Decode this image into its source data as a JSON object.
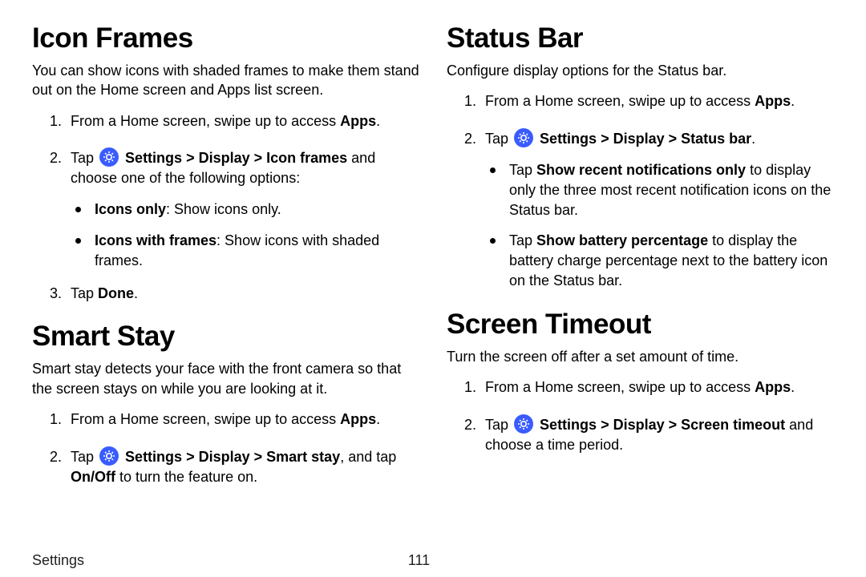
{
  "footer": {
    "section": "Settings",
    "page": "111"
  },
  "left": {
    "iconFrames": {
      "title": "Icon Frames",
      "intro": "You can show icons with shaded frames to make them stand out on the Home screen and Apps list screen.",
      "step1_pre": "From a Home screen, swipe up to access ",
      "step1_apps": "Apps",
      "step1_post": ".",
      "step2_pre": "Tap ",
      "step2_settings": "Settings",
      "step2_sep1": " > ",
      "step2_display": "Display",
      "step2_sep2": " > ",
      "step2_item": "Icon frames",
      "step2_post": " and choose one of the following options:",
      "b1_label": "Icons only",
      "b1_rest": ": Show icons only.",
      "b2_label": "Icons with frames",
      "b2_rest": ": Show icons with shaded frames.",
      "step3_pre": "Tap ",
      "step3_done": "Done",
      "step3_post": "."
    },
    "smartStay": {
      "title": "Smart Stay",
      "intro": "Smart stay detects your face with the front camera so that the screen stays on while you are looking at it.",
      "step1_pre": "From a Home screen, swipe up to access ",
      "step1_apps": "Apps",
      "step1_post": ".",
      "step2_pre": "Tap ",
      "step2_settings": "Settings",
      "step2_sep1": " > ",
      "step2_display": "Display",
      "step2_sep2": " > ",
      "step2_item": "Smart stay",
      "step2_mid": ", and tap ",
      "step2_onoff": "On/Off",
      "step2_post": " to turn the feature on."
    }
  },
  "right": {
    "statusBar": {
      "title": "Status Bar",
      "intro": "Configure display options for the Status bar.",
      "step1_pre": "From a Home screen, swipe up to access ",
      "step1_apps": "Apps",
      "step1_post": ".",
      "step2_pre": "Tap ",
      "step2_settings": "Settings",
      "step2_sep1": " > ",
      "step2_display": "Display",
      "step2_sep2": " > ",
      "step2_item": "Status bar",
      "step2_post": ".",
      "b1_pre": "Tap ",
      "b1_label": "Show recent notifications only",
      "b1_rest": " to display only the three most recent notification icons on the Status bar.",
      "b2_pre": "Tap ",
      "b2_label": "Show battery percentage",
      "b2_rest": " to display the battery charge percentage next to the battery icon on the Status bar."
    },
    "screenTimeout": {
      "title": "Screen Timeout",
      "intro": "Turn the screen off after a set amount of time.",
      "step1_pre": "From a Home screen, swipe up to access ",
      "step1_apps": "Apps",
      "step1_post": ".",
      "step2_pre": "Tap ",
      "step2_settings": "Settings",
      "step2_sep1": " > ",
      "step2_display": "Display",
      "step2_sep2": " > ",
      "step2_item": "Screen timeout",
      "step2_post": " and choose a time period."
    }
  }
}
